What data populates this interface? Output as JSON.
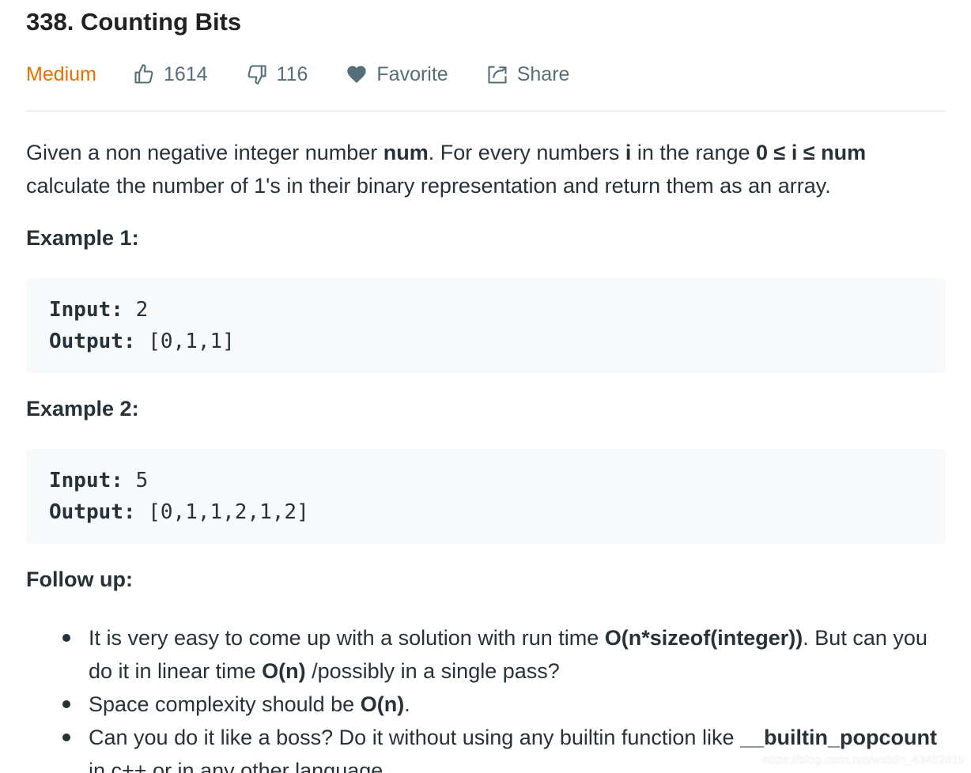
{
  "problem": {
    "title": "338. Counting Bits",
    "difficulty": "Medium",
    "likes": "1614",
    "dislikes": "116",
    "favorite_label": "Favorite",
    "share_label": "Share",
    "colors": {
      "difficulty": "#ef6c00",
      "meta": "#546e7a",
      "text": "#263238",
      "code_bg": "#f7f9fa"
    },
    "icons": {
      "like": "thumbs-up-icon",
      "dislike": "thumbs-down-icon",
      "favorite": "heart-icon",
      "share": "share-icon"
    }
  },
  "description": {
    "p1_text1": "Given a non negative integer number ",
    "p1_bold1": "num",
    "p1_text2": ". For every numbers ",
    "p1_bold2": "i",
    "p1_text3": " in the range ",
    "p1_bold3": "0 ≤ i ≤ num",
    "p1_text4": " calculate the number of 1's in their binary representation and return them as an array."
  },
  "examples": [
    {
      "heading": "Example 1:",
      "input_label": "Input:",
      "input_value": " 2",
      "output_label": "Output:",
      "output_value": " [0,1,1]"
    },
    {
      "heading": "Example 2:",
      "input_label": "Input:",
      "input_value": " 5",
      "output_label": "Output:",
      "output_value": " [0,1,1,2,1,2]"
    }
  ],
  "follow_up": {
    "heading": "Follow up:",
    "items": [
      {
        "t1": "It is very easy to come up with a solution with run time ",
        "b1": "O(n*sizeof(integer))",
        "t2": ". But can you do it in linear time ",
        "b2": "O(n)",
        "t3": " /possibly in a single pass?"
      },
      {
        "t1": "Space complexity should be ",
        "b1": "O(n)",
        "t2": "."
      },
      {
        "t1": "Can you do it like a boss? Do it without using any builtin function like ",
        "b1": "__builtin_popcount",
        "t2": " in c++ or in any other language."
      }
    ]
  },
  "watermark": "https://blog.csdn.net/weixin_43462819"
}
